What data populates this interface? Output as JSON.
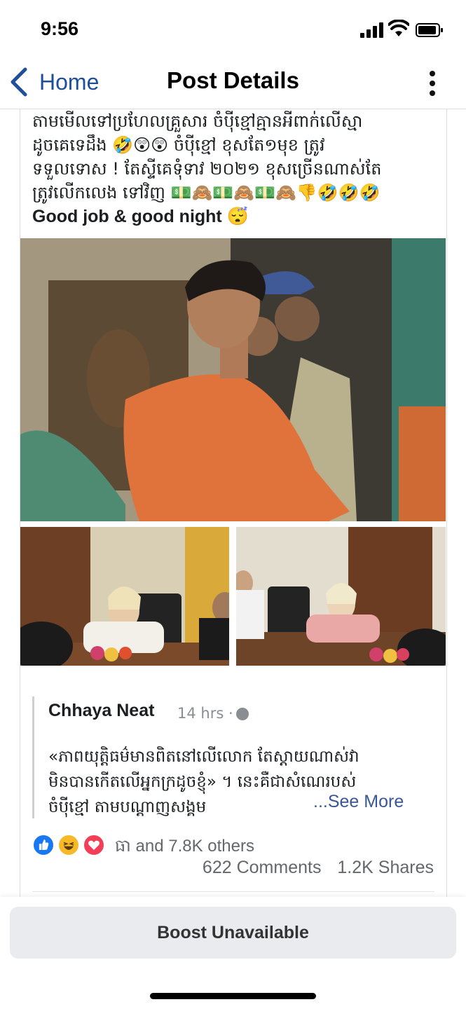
{
  "status_bar": {
    "time": "9:56"
  },
  "nav": {
    "back_label": "Home",
    "title": "Post Details"
  },
  "post": {
    "text_lines": [
      "តាមមើលទៅប្រហែលគ្រួសារ ចំប៉ីខ្មៅគ្មានអីពាក់លើស្មា",
      "ដូចគេទេដឹង 🤣😲😲 ចំប៉ីខ្មៅ ខុសតែ១មុខ ត្រូវ",
      "ទទួលទោស ! តែស្ទីគេទុំទាវ ២០២១ ខុសច្រើនណាស់តែ",
      "ត្រូវលើកលេង ទៅវិញ 💵🙈💵🙈💵🙈👎🤣🤣🤣"
    ],
    "text_en": "Good job & good night 😴"
  },
  "shared_post": {
    "author": "Chhaya Neat",
    "time": "14 hrs ·",
    "text_lines": [
      "«ភាពយុត្តិធម៌មានពិតនៅលើលោក តែស្តាយណាស់វា",
      "មិនបានកើតលើអ្នកក្រដូចខ្ញុំ» ។ នេះគឺជាសំណេរបស់",
      "ចំប៉ីខ្មៅ តាមបណ្តាញសង្គម"
    ],
    "see_more": "...See More"
  },
  "reactions": {
    "icons": [
      "like-icon",
      "haha-icon",
      "love-icon"
    ],
    "summary": "ធា and 7.8K others"
  },
  "counts": {
    "comments": "622 Comments",
    "shares": "1.2K Shares"
  },
  "footer": {
    "boost_label": "Boost Unavailable"
  },
  "colors": {
    "link_blue": "#385898",
    "nav_blue": "#1f4f9a",
    "like_blue": "#1877f2",
    "love_red": "#f33e58",
    "haha_yellow": "#f7b928"
  }
}
